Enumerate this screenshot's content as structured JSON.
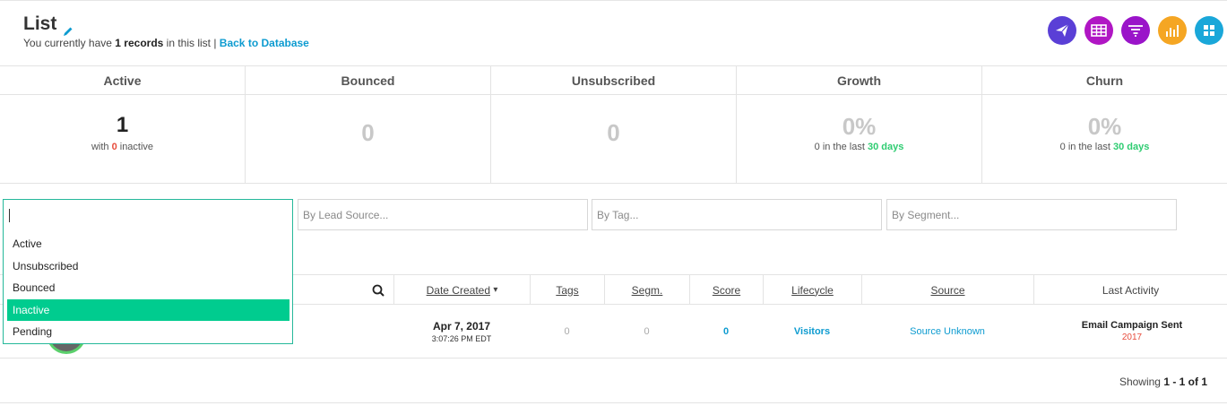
{
  "header": {
    "title": "List",
    "subtitle_prefix": "You currently have ",
    "record_count": "1 records",
    "subtitle_suffix": " in this list | ",
    "back_link": "Back to Database",
    "icons": [
      {
        "name": "send-icon",
        "color": "#5a3fd6"
      },
      {
        "name": "table-icon",
        "color": "#b016c4"
      },
      {
        "name": "funnel-icon",
        "color": "#9a14c9"
      },
      {
        "name": "bar-chart-icon",
        "color": "#f5a623"
      },
      {
        "name": "grid-icon",
        "color": "#1aa7d9"
      }
    ]
  },
  "stats": [
    {
      "label": "Active",
      "value": "1",
      "sub_prefix": "with ",
      "sub_highlight": "0",
      "sub_suffix": " inactive"
    },
    {
      "label": "Bounced",
      "value": "0"
    },
    {
      "label": "Unsubscribed",
      "value": "0"
    },
    {
      "label": "Growth",
      "value": "0%",
      "sub_prefix": "0 in the last ",
      "sub_highlight": "30 days"
    },
    {
      "label": "Churn",
      "value": "0%",
      "sub_prefix": "0 in the last ",
      "sub_highlight": "30 days"
    }
  ],
  "filters": {
    "lead_source_placeholder": "By Lead Source...",
    "tag_placeholder": "By Tag...",
    "segment_placeholder": "By Segment..."
  },
  "status_dropdown": {
    "value": "",
    "options": [
      "Active",
      "Unsubscribed",
      "Bounced",
      "Inactive",
      "Pending"
    ],
    "highlighted": "Inactive"
  },
  "table": {
    "columns": {
      "date_created": "Date Created",
      "tags": "Tags",
      "segments": "Segm.",
      "score": "Score",
      "lifecycle": "Lifecycle",
      "source": "Source",
      "last_activity": "Last Activity"
    },
    "sort_indicator": "▾",
    "rows": [
      {
        "date": "Apr 7, 2017",
        "time": "3:07:26 PM EDT",
        "tags": "0",
        "segments": "0",
        "score": "0",
        "lifecycle": "Visitors",
        "source": "Source Unknown",
        "last_activity": "Email Campaign Sent",
        "last_activity_year": "2017"
      }
    ]
  },
  "footer": {
    "showing_prefix": "Showing ",
    "showing_range": "1 - 1 of 1"
  }
}
